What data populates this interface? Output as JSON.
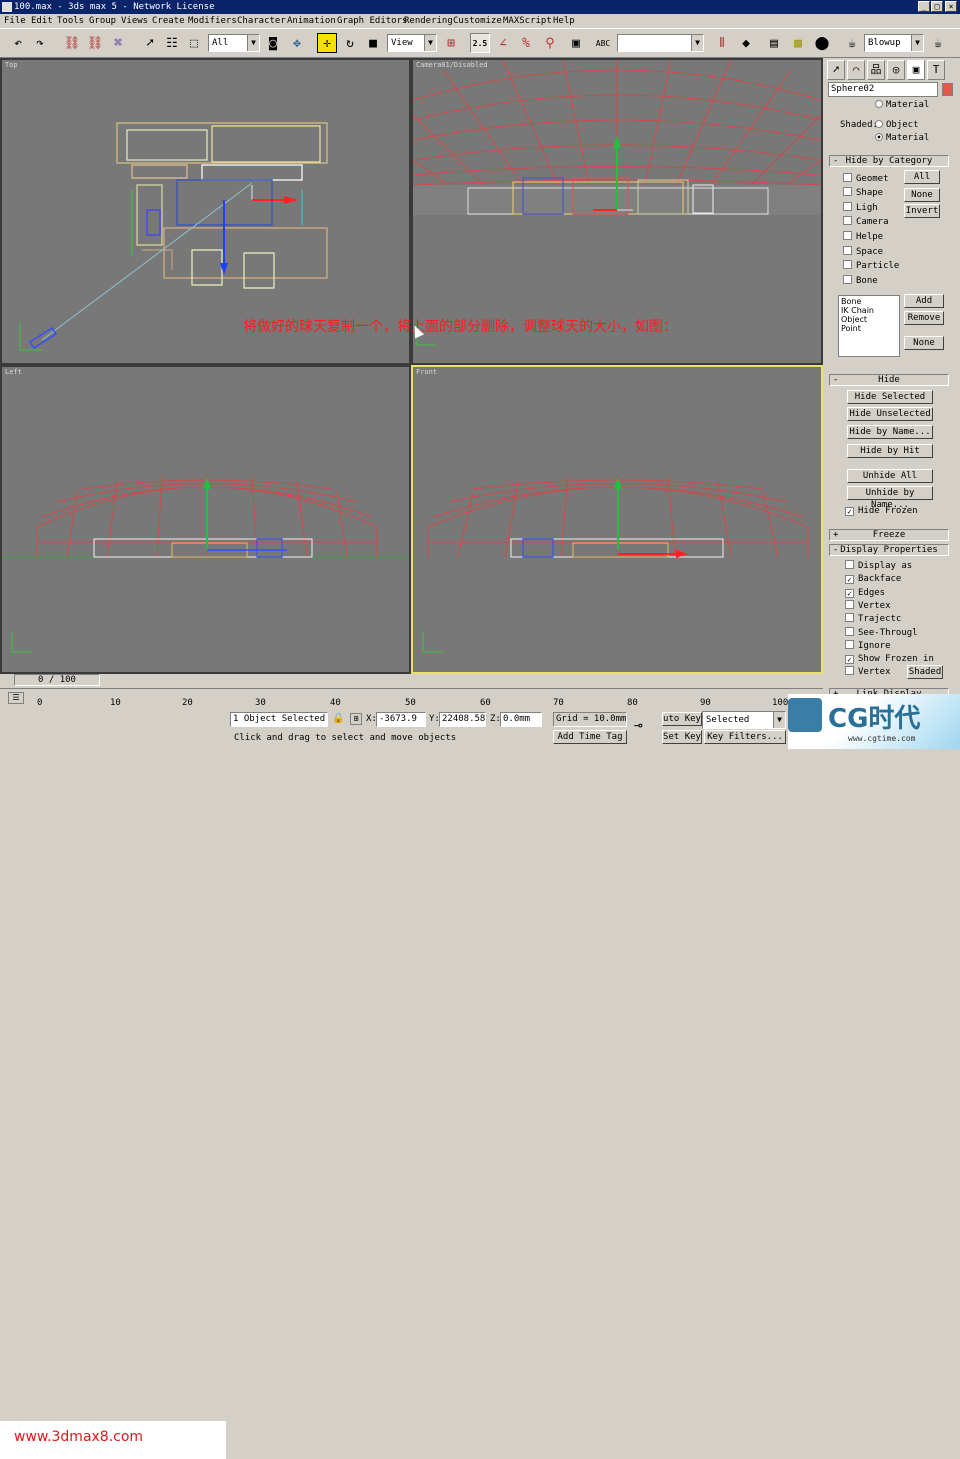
{
  "window": {
    "title": "100.max - 3ds max 5 - Network License"
  },
  "menu": [
    "File",
    "Edit",
    "Tools",
    "Group",
    "Views",
    "Create",
    "Modifiers",
    "Character",
    "Animation",
    "Graph Editors",
    "Rendering",
    "Customize",
    "MAXScript",
    "Help"
  ],
  "toolbar": {
    "selection_filter": "All",
    "ref_coord": "View",
    "named_selection": "",
    "render_type": "Blowup",
    "snap_value": "2.5"
  },
  "viewports": {
    "top": {
      "label": "Top"
    },
    "camera": {
      "label": "Camera01/Disabled"
    },
    "left": {
      "label": "Left"
    },
    "front": {
      "label": "Front"
    }
  },
  "overlay_text": "将做好的球天复制一个，将上面的部分删除，调整球天的大小，如图：",
  "command_panel": {
    "object_name": "Sphere02",
    "color": "#e05a4a",
    "display_color": {
      "shaded_label": "Shaded:",
      "radio_material_top": "Material",
      "radio_object": "Object",
      "radio_material": "Material"
    },
    "hide_by_category": {
      "title": "Hide by Category",
      "items": [
        {
          "label": "Geomet",
          "checked": false
        },
        {
          "label": "Shape",
          "checked": false
        },
        {
          "label": "Ligh",
          "checked": false
        },
        {
          "label": "Camera",
          "checked": false
        },
        {
          "label": "Helpe",
          "checked": false
        },
        {
          "label": "Space",
          "checked": false
        },
        {
          "label": "Particle",
          "checked": false
        },
        {
          "label": "Bone",
          "checked": false
        }
      ],
      "btn_all": "All",
      "btn_none": "None",
      "btn_invert": "Invert",
      "list": [
        "Bone",
        "IK Chain Object",
        "Point"
      ],
      "btn_add": "Add",
      "btn_remove": "Remove",
      "btn_none2": "None"
    },
    "hide": {
      "title": "Hide",
      "hide_selected": "Hide Selected",
      "hide_unselected": "Hide Unselected",
      "hide_by_name": "Hide by Name...",
      "hide_by_hit": "Hide by Hit",
      "unhide_all": "Unhide All",
      "unhide_by_name": "Unhide by Name...",
      "hide_frozen": "Hide Frozen"
    },
    "freeze": {
      "title": "Freeze"
    },
    "display_properties": {
      "title": "Display Properties",
      "items": [
        {
          "label": "Display as",
          "checked": false
        },
        {
          "label": "Backface",
          "checked": true
        },
        {
          "label": "Edges",
          "checked": true
        },
        {
          "label": "Vertex",
          "checked": false
        },
        {
          "label": "Trajectc",
          "checked": false
        },
        {
          "label": "See-Througl",
          "checked": false
        },
        {
          "label": "Ignore",
          "checked": false
        },
        {
          "label": "Show Frozen in",
          "checked": true
        },
        {
          "label": "Vertex",
          "checked": false
        }
      ],
      "shaded_btn": "Shaded"
    },
    "link_display": {
      "title": "Link Display"
    }
  },
  "timeline": {
    "frame": "0 / 100",
    "ticks": [
      "0",
      "10",
      "20",
      "30",
      "40",
      "50",
      "60",
      "70",
      "80",
      "90",
      "100"
    ]
  },
  "status": {
    "watermark": "www.3dmax8.com",
    "selected": "1 Object Selected",
    "x": "-3673.9",
    "y": "22408.58",
    "z": "0.0mm",
    "grid": "Grid = 10.0mm",
    "prompt": "Click and drag to select and move objects",
    "add_time_tag": "Add Time Tag",
    "auto_key": "uto Key",
    "selected_mode": "Selected",
    "set_key": "Set Key",
    "key_filters": "Key Filters..."
  },
  "logo": {
    "text": "CG时代",
    "url": "www.cgtime.com"
  }
}
